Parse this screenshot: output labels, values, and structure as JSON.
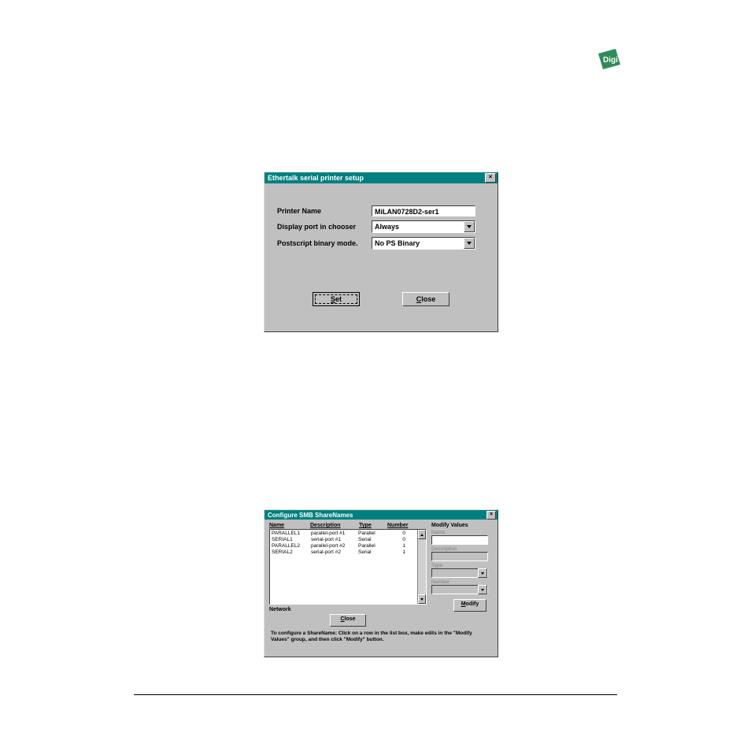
{
  "dlg1": {
    "title": "Ethertalk serial printer setup",
    "close_x": "×",
    "rows": {
      "printer_name_label": "Printer Name",
      "printer_name_value": "MiLAN0728D2-ser1",
      "display_port_label": "Display port in chooser",
      "display_port_value": "Always",
      "ps_binary_label": "Postscript binary mode.",
      "ps_binary_value": "No PS Binary"
    },
    "buttons": {
      "set_prefix": "S",
      "set_rest": "et",
      "close_prefix": "C",
      "close_rest": "lose"
    }
  },
  "dlg2": {
    "title": "Configure SMB ShareNames",
    "close_x": "×",
    "headers": {
      "name": "Name",
      "description": "Description",
      "type": "Type",
      "number": "Number"
    },
    "rows": [
      {
        "name": "PARALLEL1",
        "desc": "parallel-port #1",
        "type": "Parallel",
        "num": "0"
      },
      {
        "name": "SERIAL1",
        "desc": "serial-port #1",
        "type": "Serial",
        "num": "0"
      },
      {
        "name": "PARALLEL2",
        "desc": "parallel-port #2",
        "type": "Parallel",
        "num": "1"
      },
      {
        "name": "SERIAL2",
        "desc": "serial-port #2",
        "type": "Serial",
        "num": "1"
      }
    ],
    "network_label": "Network",
    "group_title": "Modify Values",
    "field_labels": {
      "name": "Name",
      "description": "Description",
      "type": "Type",
      "number": "Number"
    },
    "buttons": {
      "modify_prefix": "M",
      "modify_rest": "odify",
      "close_prefix": "C",
      "close_rest": "lose"
    },
    "hint": "To configure a ShareName: Click on a row in the list box, make edits in the \"Modify Values\" group, and then click \"Modify\" button."
  }
}
